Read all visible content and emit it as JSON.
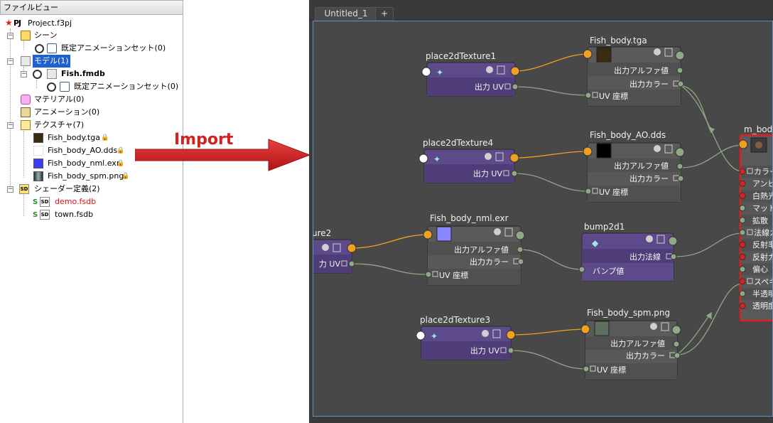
{
  "file_view": {
    "header": "ファイルビュー",
    "project": {
      "label": "Project.f3pj"
    },
    "items": {
      "scene": "シーン",
      "scene_anim": "既定アニメーションセット(0)",
      "model": "モデル(1)",
      "fish_model": "Fish.fmdb",
      "fish_anim": "既定アニメーションセット(0)",
      "material": "マテリアル(0)",
      "animation": "アニメーション(0)",
      "texture": "テクスチャ(7)",
      "tex1": "Fish_body.tga",
      "tex2": "Fish_body_AO.dds",
      "tex3": "Fish_body_nml.exr",
      "tex4": "Fish_body_spm.png",
      "shader": "シェーダー定義(2)",
      "shader1": "demo.fsdb",
      "shader2": "town.fsdb"
    }
  },
  "arrow": {
    "label": "Import",
    "color": "#d42020"
  },
  "editor": {
    "tabs": {
      "untitled": "Untitled_1",
      "add": "+"
    },
    "nodes": {
      "p1": {
        "title": "place2dTexture1",
        "out": "出力 UV"
      },
      "p4": {
        "title": "place2dTexture4",
        "out": "出力 UV"
      },
      "p2": {
        "title": "ure2",
        "out": "力 UV"
      },
      "p3": {
        "title": "place2dTexture3",
        "out": "出力 UV"
      },
      "t1": {
        "title": "Fish_body.tga",
        "alpha": "出力アルファ値",
        "color": "出力カラー",
        "uv": "UV 座標"
      },
      "t2": {
        "title": "Fish_body_AO.dds",
        "alpha": "出力アルファ値",
        "color": "出力カラー",
        "uv": "UV 座標"
      },
      "t3": {
        "title": "Fish_body_nml.exr",
        "alpha": "出力アルファ値",
        "color": "出力カラー",
        "uv": "UV 座標"
      },
      "t4": {
        "title": "Fish_body_spm.png",
        "alpha": "出力アルファ値",
        "color": "出力カラー",
        "uv": "UV 座標"
      },
      "bump": {
        "title": "bump2d1",
        "out": "出力法線",
        "in": "バンプ値"
      },
      "mat": {
        "title": "m_bod",
        "inputs": [
          "カラー",
          "アンビエ",
          "白熱光",
          "マットの",
          "拡散",
          "法線カ",
          "反射率",
          "反射カ",
          "偏心",
          "スペキ",
          "半透明",
          "透明度"
        ]
      }
    }
  }
}
